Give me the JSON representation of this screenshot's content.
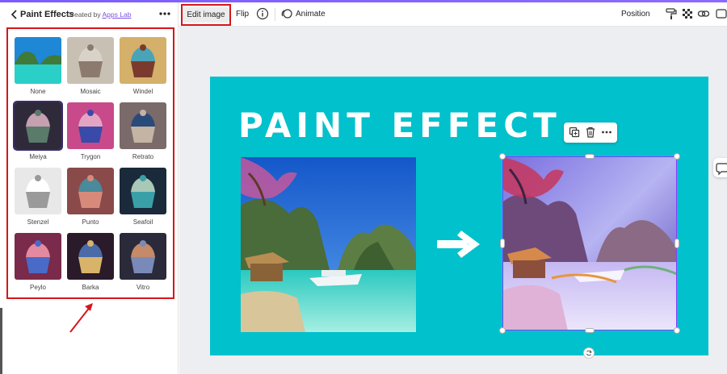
{
  "panel": {
    "title": "Paint Effects",
    "created_by_prefix": "Created by",
    "created_by_link": "Apps Lab",
    "effects": [
      {
        "label": "None"
      },
      {
        "label": "Mosaic"
      },
      {
        "label": "Windel"
      },
      {
        "label": "Meiya",
        "selected": true
      },
      {
        "label": "Trygon"
      },
      {
        "label": "Retrato"
      },
      {
        "label": "Stenzel"
      },
      {
        "label": "Punto"
      },
      {
        "label": "Seafoil"
      },
      {
        "label": "Peylo"
      },
      {
        "label": "Barka"
      },
      {
        "label": "Vitro"
      }
    ]
  },
  "toolbar": {
    "edit_image": "Edit image",
    "flip": "Flip",
    "animate": "Animate",
    "position": "Position",
    "icons": [
      "info-icon",
      "animate-icon",
      "paint-roller-icon",
      "transparency-icon",
      "link-icon"
    ]
  },
  "design": {
    "title": "PAINT EFFECT",
    "background": "#00c1cc"
  },
  "floating_toolbar": {
    "icons": [
      "duplicate-icon",
      "trash-icon",
      "more-icon"
    ]
  },
  "colors": {
    "accent_purple": "#8b3dff",
    "highlight_red": "#d6161b",
    "link_purple": "#7b4fe0"
  }
}
